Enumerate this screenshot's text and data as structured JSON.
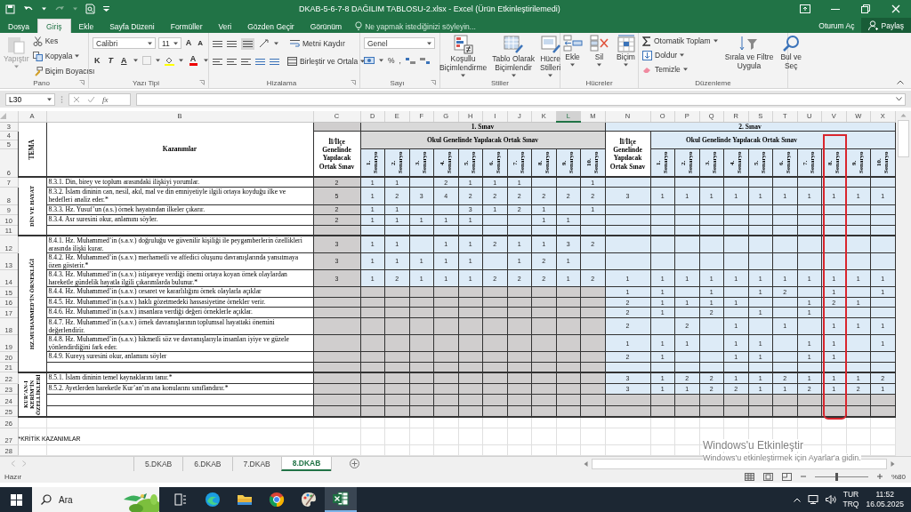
{
  "title_bar": {
    "title": "DKAB-5-6-7-8 DAĞILIM TABLOSU-2.xlsx - Excel (Ürün Etkinleştirilemedi)"
  },
  "tabs": [
    {
      "label": "Dosya",
      "selected": false
    },
    {
      "label": "Giriş",
      "selected": true
    },
    {
      "label": "Ekle",
      "selected": false
    },
    {
      "label": "Sayfa Düzeni",
      "selected": false
    },
    {
      "label": "Formüller",
      "selected": false
    },
    {
      "label": "Veri",
      "selected": false
    },
    {
      "label": "Gözden Geçir",
      "selected": false
    },
    {
      "label": "Görünüm",
      "selected": false
    }
  ],
  "tell_me": {
    "placeholder": "Ne yapmak istediğinizi söyleyin..."
  },
  "account": {
    "sign_in": "Oturum Aç",
    "share": "Paylaş"
  },
  "ribbon": {
    "clipboard": {
      "label": "Pano",
      "paste": "Yapıştır",
      "paste_disabled": true,
      "cut": "Kes",
      "copy": "Kopyala",
      "format_painter": "Biçim Boyacısı"
    },
    "font": {
      "label": "Yazı Tipi",
      "family": "Calibri",
      "size": "11",
      "grow_font": "A",
      "shrink_font": "A",
      "bold": "K",
      "italic": "T",
      "underline": "A",
      "font_color": "A"
    },
    "alignment": {
      "label": "Hizalama",
      "wrap": "Metni Kaydır",
      "merge": "Birleştir ve Ortala"
    },
    "number": {
      "label": "Sayı",
      "format": "Genel",
      "percent": "%",
      "comma": ","
    },
    "styles": {
      "label": "Stiller",
      "items": [
        {
          "kind": "conditional",
          "lines": [
            "Koşullu",
            "Biçimlendirme"
          ]
        },
        {
          "kind": "table",
          "lines": [
            "Tablo Olarak",
            "Biçimlendir"
          ]
        },
        {
          "kind": "cell",
          "lines": [
            "Hücre",
            "Stilleri"
          ]
        }
      ]
    },
    "cells": {
      "label": "Hücreler",
      "items": [
        {
          "kind": "insert",
          "label": "Ekle"
        },
        {
          "kind": "delete",
          "label": "Sil"
        },
        {
          "kind": "format",
          "label": "Biçim"
        }
      ]
    },
    "editing": {
      "label": "Düzenleme",
      "autosum": "Otomatik Toplam",
      "fill": "Doldur",
      "clear": "Temizle",
      "sort": [
        "Sırala ve Filtre",
        "Uygula"
      ],
      "find": [
        "Bul ve",
        "Seç"
      ]
    }
  },
  "formula_bar": {
    "name_box": "L30",
    "fx": "fx"
  },
  "sheet": {
    "columns": [
      {
        "label": "A",
        "selected": false,
        "outlined": false
      },
      {
        "label": "B",
        "selected": false,
        "outlined": false
      },
      {
        "label": "C",
        "selected": false,
        "outlined": false
      },
      {
        "label": "D",
        "selected": false,
        "outlined": false
      },
      {
        "label": "E",
        "selected": false,
        "outlined": false
      },
      {
        "label": "F",
        "selected": false,
        "outlined": false
      },
      {
        "label": "G",
        "selected": false,
        "outlined": false
      },
      {
        "label": "H",
        "selected": false,
        "outlined": false
      },
      {
        "label": "I",
        "selected": false,
        "outlined": false
      },
      {
        "label": "J",
        "selected": false,
        "outlined": false
      },
      {
        "label": "K",
        "selected": false,
        "outlined": false
      },
      {
        "label": "L",
        "selected": true,
        "outlined": false
      },
      {
        "label": "M",
        "selected": false,
        "outlined": false
      },
      {
        "label": "N",
        "selected": false,
        "outlined": false
      },
      {
        "label": "O",
        "selected": false,
        "outlined": false
      },
      {
        "label": "P",
        "selected": false,
        "outlined": false
      },
      {
        "label": "Q",
        "selected": false,
        "outlined": false
      },
      {
        "label": "R",
        "selected": false,
        "outlined": false
      },
      {
        "label": "S",
        "selected": false,
        "outlined": false
      },
      {
        "label": "T",
        "selected": false,
        "outlined": false
      },
      {
        "label": "U",
        "selected": false,
        "outlined": false
      },
      {
        "label": "V",
        "selected": false,
        "outlined": true
      },
      {
        "label": "W",
        "selected": false,
        "outlined": false
      },
      {
        "label": "X",
        "selected": false,
        "outlined": false
      }
    ],
    "header": {
      "rows": [
        "3",
        "4",
        "5",
        "6"
      ],
      "tema": "TEMA",
      "kazanimlar": "Kazanımlar",
      "exams": [
        {
          "title": "1. Sınav",
          "shaded": true,
          "title_covers_il_ilce": false,
          "il_ilce": "İl/İlçe Genelinde Yapılacak Ortak Sınav",
          "okul": "Okul Genelinde Yapılacak Ortak Sınav",
          "scenarios": [
            "1. Senaryo",
            "2. Senaryo",
            "3. Senaryo",
            "4. Senaryo",
            "5. Senaryo",
            "6. Senaryo",
            "7. Senaryo",
            "8. Senaryo",
            "9. Senaryo",
            "10. Senaryo"
          ]
        },
        {
          "title": "2. Sınav",
          "shaded": false,
          "title_covers_il_ilce": true,
          "il_ilce": "İl/İlçe Genelinde Yapılacak Ortak Sınav",
          "okul": "Okul Genelinde Yapılacak Ortak Sınav",
          "scenarios": [
            "1. Senaryo",
            "2. Senaryo",
            "3. Senaryo",
            "4. Senaryo",
            "5. Senaryo",
            "6. Senaryo",
            "7. Senaryo",
            "8. Senaryo",
            "9. Senaryo",
            "10. Senaryo"
          ]
        }
      ]
    },
    "themes": [
      {
        "name": "DİN VE HAYAT",
        "rows": [
          {
            "row": "7",
            "text": "8.3.1. Din, birey ve toplum arasındaki ilişkiyi yorumlar.",
            "exams": [
              {
                "shaded": false,
                "il_ilce": "2",
                "cells": [
                  {
                    "value": "1"
                  },
                  {
                    "value": "1"
                  },
                  {},
                  {
                    "value": "2"
                  },
                  {
                    "value": "1"
                  },
                  {
                    "value": "1"
                  },
                  {
                    "value": "1"
                  },
                  {},
                  {},
                  {
                    "value": "1"
                  }
                ]
              },
              {
                "shaded": false
              }
            ]
          },
          {
            "row": "8",
            "text": "8.3.2. İslam dininin can, nesil, akıl, mal ve din emniyetiyle ilgili ortaya koyduğu ilke ve hedefleri analiz eder.*",
            "exams": [
              {
                "shaded": false,
                "il_ilce": "5",
                "cells": [
                  {
                    "value": "1"
                  },
                  {
                    "value": "2"
                  },
                  {
                    "value": "3"
                  },
                  {
                    "value": "4"
                  },
                  {
                    "value": "2"
                  },
                  {
                    "value": "2"
                  },
                  {
                    "value": "2"
                  },
                  {
                    "value": "2"
                  },
                  {
                    "value": "2"
                  },
                  {
                    "value": "2"
                  }
                ]
              },
              {
                "shaded": false,
                "il_ilce": "3",
                "cells": [
                  {
                    "value": "1"
                  },
                  {
                    "value": "1"
                  },
                  {
                    "value": "1"
                  },
                  {
                    "value": "1"
                  },
                  {
                    "value": "1"
                  },
                  {
                    "value": "1"
                  },
                  {
                    "value": "1"
                  },
                  {
                    "value": "1"
                  },
                  {
                    "value": "1"
                  },
                  {
                    "value": "1"
                  }
                ]
              }
            ]
          },
          {
            "row": "9",
            "text": "8.3.3. Hz. Yusuf’un (a.s.) örnek hayatından ilkeler çıkarır.",
            "exams": [
              {
                "shaded": false,
                "il_ilce": "2",
                "cells": [
                  {
                    "value": "1"
                  },
                  {
                    "value": "1"
                  },
                  {},
                  {},
                  {
                    "value": "3"
                  },
                  {
                    "value": "1"
                  },
                  {
                    "value": "2"
                  },
                  {
                    "value": "1"
                  },
                  {},
                  {
                    "value": "1"
                  }
                ]
              },
              {
                "shaded": false
              }
            ]
          },
          {
            "row": "10",
            "text": "8.3.4. Asr suresini okur, anlamını söyler.",
            "exams": [
              {
                "shaded": false,
                "il_ilce": "2",
                "cells": [
                  {
                    "value": "1"
                  },
                  {
                    "value": "1"
                  },
                  {
                    "value": "1"
                  },
                  {
                    "value": "1"
                  },
                  {
                    "value": "1"
                  },
                  {},
                  {},
                  {
                    "value": "1"
                  },
                  {
                    "value": "1"
                  },
                  {}
                ]
              },
              {
                "shaded": false
              }
            ]
          },
          {
            "row": "11",
            "exams": [
              {
                "shaded": false
              },
              {
                "shaded": false
              }
            ]
          }
        ]
      },
      {
        "name": "HZ.MUHAMMED’İN ÖRNEKLİĞİ",
        "rows": [
          {
            "row": "12",
            "text": "8.4.1. Hz. Muhammed’in (s.a.v.) doğruluğu ve güvenilir kişiliği ile peygamberlerin özellikleri arasında ilişki kurar.",
            "exams": [
              {
                "shaded": false,
                "il_ilce": "3",
                "cells": [
                  {
                    "value": "1"
                  },
                  {
                    "value": "1"
                  },
                  {},
                  {
                    "value": "1"
                  },
                  {
                    "value": "1"
                  },
                  {
                    "value": "2"
                  },
                  {
                    "value": "1"
                  },
                  {
                    "value": "1"
                  },
                  {
                    "value": "3"
                  },
                  {
                    "value": "2"
                  }
                ]
              },
              {
                "shaded": false
              }
            ]
          },
          {
            "row": "13",
            "text": "8.4.2. Hz. Muhammed’in (s.a.v.) merhametli ve affedici oluşunu davranışlarında yansıtmaya özen gösterir.*",
            "exams": [
              {
                "shaded": false,
                "il_ilce": "3",
                "cells": [
                  {
                    "value": "1"
                  },
                  {
                    "value": "1"
                  },
                  {
                    "value": "1"
                  },
                  {
                    "value": "1"
                  },
                  {
                    "value": "1"
                  },
                  {},
                  {
                    "value": "1"
                  },
                  {
                    "value": "2"
                  },
                  {
                    "value": "1"
                  },
                  {}
                ]
              },
              {
                "shaded": false
              }
            ]
          },
          {
            "row": "14",
            "text": "8.4.3. Hz. Muhammed’in (s.a.v.) istişareye verdiği önemi ortaya koyan örnek olaylardan hareketle gündelik hayatla ilgili çıkarımlarda bulunur.*",
            "exams": [
              {
                "shaded": false,
                "il_ilce": "3",
                "cells": [
                  {
                    "value": "1"
                  },
                  {
                    "value": "2"
                  },
                  {
                    "value": "1"
                  },
                  {
                    "value": "1"
                  },
                  {
                    "value": "1"
                  },
                  {
                    "value": "2"
                  },
                  {
                    "value": "2"
                  },
                  {
                    "value": "2"
                  },
                  {
                    "value": "1"
                  },
                  {
                    "value": "2"
                  }
                ]
              },
              {
                "shaded": false,
                "il_ilce": "1",
                "cells": [
                  {
                    "value": "1"
                  },
                  {
                    "value": "1"
                  },
                  {
                    "value": "1"
                  },
                  {
                    "value": "1"
                  },
                  {
                    "value": "1"
                  },
                  {
                    "value": "1"
                  },
                  {
                    "value": "1"
                  },
                  {
                    "value": "1"
                  },
                  {
                    "value": "1"
                  },
                  {
                    "value": "1"
                  }
                ]
              }
            ]
          },
          {
            "row": "15",
            "text": "8.4.4. Hz. Muhammed’in (s.a.v.) cesaret ve kararlılığını örnek olaylarla açıklar",
            "exams": [
              {
                "shaded": true
              },
              {
                "shaded": false,
                "il_ilce": "1",
                "cells": [
                  {
                    "value": "1"
                  },
                  {},
                  {
                    "value": "1"
                  },
                  {},
                  {
                    "value": "1"
                  },
                  {
                    "value": "2"
                  },
                  {},
                  {
                    "value": "1"
                  },
                  {},
                  {
                    "value": "1"
                  }
                ]
              }
            ]
          },
          {
            "row": "16",
            "text": "8.4.5. Hz. Muhammed’in (s.a.v.) haklı gözetmedeki hassasiyetine örnekler verir.",
            "exams": [
              {
                "shaded": true
              },
              {
                "shaded": false,
                "il_ilce": "2",
                "cells": [
                  {
                    "value": "1"
                  },
                  {
                    "value": "1"
                  },
                  {
                    "value": "1"
                  },
                  {
                    "value": "1"
                  },
                  {},
                  {},
                  {
                    "value": "1"
                  },
                  {
                    "value": "2"
                  },
                  {
                    "value": "1"
                  },
                  {}
                ]
              }
            ]
          },
          {
            "row": "17",
            "text": "8.4.6. Hz. Muhammed’in (s.a.v.) insanlara verdiği değeri örneklerle açıklar.",
            "exams": [
              {
                "shaded": true
              },
              {
                "shaded": false,
                "il_ilce": "2",
                "cells": [
                  {
                    "value": "1"
                  },
                  {},
                  {
                    "value": "2"
                  },
                  {},
                  {
                    "value": "1"
                  },
                  {},
                  {
                    "value": "1"
                  },
                  {},
                  {},
                  {}
                ]
              }
            ]
          },
          {
            "row": "18",
            "text": "8.4.7. Hz. Muhammed’in (s.a.v.) örnek davranışlarının toplumsal hayattaki önemini değerlendirir.",
            "exams": [
              {
                "shaded": true
              },
              {
                "shaded": false,
                "il_ilce": "2",
                "cells": [
                  {},
                  {
                    "value": "2"
                  },
                  {},
                  {
                    "value": "1"
                  },
                  {},
                  {
                    "value": "1"
                  },
                  {},
                  {
                    "value": "1"
                  },
                  {
                    "value": "1"
                  },
                  {
                    "value": "1"
                  }
                ]
              }
            ]
          },
          {
            "row": "19",
            "text": "8.4.8. Hz. Muhammed’in (s.a.v.) hikmetli söz ve davranışlarıyla insanları iyiye ve güzele yönlendirdiğini fark eder.",
            "exams": [
              {
                "shaded": true
              },
              {
                "shaded": false,
                "il_ilce": "1",
                "cells": [
                  {
                    "value": "1"
                  },
                  {
                    "value": "1"
                  },
                  {},
                  {
                    "value": "1"
                  },
                  {
                    "value": "1"
                  },
                  {},
                  {
                    "value": "1"
                  },
                  {
                    "value": "1"
                  },
                  {},
                  {
                    "value": "1"
                  }
                ]
              }
            ]
          },
          {
            "row": "20",
            "text": "8.4.9. Kureyş suresini okur, anlamını söyler",
            "exams": [
              {
                "shaded": true
              },
              {
                "shaded": false,
                "il_ilce": "2",
                "cells": [
                  {
                    "value": "1"
                  },
                  {},
                  {},
                  {
                    "value": "1"
                  },
                  {
                    "value": "1"
                  },
                  {},
                  {
                    "value": "1"
                  },
                  {
                    "value": "1"
                  },
                  {},
                  {}
                ]
              }
            ]
          },
          {
            "row": "21",
            "exams": [
              {
                "shaded": true
              },
              {
                "shaded": false
              }
            ]
          }
        ]
      },
      {
        "name": "KUR’AN-I KERİM’İN ÖZELLİKLERİ",
        "rows": [
          {
            "row": "22",
            "text": "8.5.1. İslam dininin temel kaynaklarını tanır.*",
            "exams": [
              {
                "shaded": true
              },
              {
                "shaded": false,
                "il_ilce": "3",
                "cells": [
                  {
                    "value": "1"
                  },
                  {
                    "value": "2"
                  },
                  {
                    "value": "2"
                  },
                  {
                    "value": "1"
                  },
                  {
                    "value": "1"
                  },
                  {
                    "value": "2"
                  },
                  {
                    "value": "1"
                  },
                  {
                    "value": "1"
                  },
                  {
                    "value": "1"
                  },
                  {
                    "value": "2"
                  }
                ]
              }
            ]
          },
          {
            "row": "23",
            "text": "8.5.2. Ayetlerden hareketle Kur’an’ın ana konularını sınıflandırır.*",
            "exams": [
              {
                "shaded": true
              },
              {
                "shaded": false,
                "il_ilce": "3",
                "cells": [
                  {
                    "value": "1"
                  },
                  {
                    "value": "1"
                  },
                  {
                    "value": "2"
                  },
                  {
                    "value": "2"
                  },
                  {
                    "value": "1"
                  },
                  {
                    "value": "1"
                  },
                  {
                    "value": "2"
                  },
                  {
                    "value": "1"
                  },
                  {
                    "value": "2"
                  },
                  {
                    "value": "1"
                  }
                ]
              }
            ]
          },
          {
            "row": "24",
            "exams": [
              {
                "shaded": true
              },
              {
                "shaded": true
              }
            ]
          },
          {
            "row": "25",
            "exams": [
              {
                "shaded": true
              },
              {
                "shaded": true
              }
            ]
          }
        ]
      }
    ],
    "after_rows": [
      {
        "row": "26"
      },
      {
        "row": "27",
        "text": "*KRİTİK KAZANIMLAR"
      },
      {
        "row": "28"
      }
    ]
  },
  "activation_notice": {
    "title": "Windows'u Etkinleştir",
    "text": "Windows'u etkinleştirmek için Ayarlar'a gidin."
  },
  "sheet_tabs": [
    {
      "label": "5.DKAB",
      "selected": false
    },
    {
      "label": "6.DKAB",
      "selected": false
    },
    {
      "label": "7.DKAB",
      "selected": false
    },
    {
      "label": "8.DKAB",
      "selected": true
    }
  ],
  "status_bar": {
    "text": "Hazır",
    "zoom": "%80",
    "zoom_slider": {
      "level": 0.38
    }
  },
  "taskbar": {
    "search": {
      "placeholder": "Ara"
    },
    "apps": [
      {
        "kind": "taskview",
        "active": false
      },
      {
        "kind": "edge",
        "active": false
      },
      {
        "kind": "explorer",
        "active": false
      },
      {
        "kind": "chrome",
        "active": false
      },
      {
        "kind": "paint",
        "active": false
      },
      {
        "kind": "excel",
        "active": true
      }
    ],
    "tray": {
      "language": "TUR",
      "layout": "TRQ",
      "time": "11:52",
      "date": "16.05.2025"
    }
  }
}
